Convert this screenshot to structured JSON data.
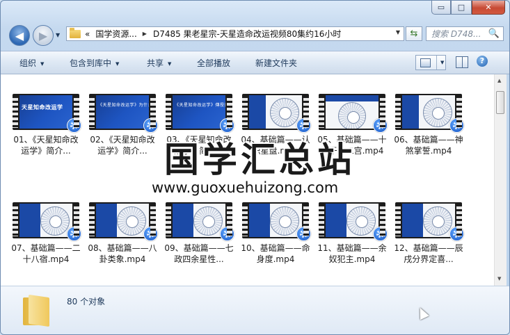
{
  "window": {
    "buttons": {
      "minimize": "▭",
      "maximize": "□",
      "close": "✕"
    }
  },
  "nav": {
    "back": "◀",
    "forward": "▶",
    "history": "▼",
    "refresh": "⇆"
  },
  "address": {
    "breadcrumbs": [
      "«",
      "国学资源...",
      "D7485 果老星宗-天星造命改运视频80集约16小时"
    ],
    "dropdown": "▼"
  },
  "search": {
    "placeholder": "搜索 D748...",
    "icon": "🔍"
  },
  "toolbar": {
    "organize": "组织",
    "include_library": "包含到库中",
    "share": "共享",
    "play_all": "全部播放",
    "new_folder": "新建文件夹"
  },
  "help": "?",
  "files": [
    {
      "name": "01、《天星知命改运学》简介...",
      "thumb_text": "天星知命改运学"
    },
    {
      "name": "02、《天星知命改运学》简介...",
      "thumb_text": "《天星知命改运学》为什么很少有人知"
    },
    {
      "name": "03、《天星知命改运学》简介...",
      "thumb_text": "《天星知命改运学》傳授的内容和意义"
    },
    {
      "name": "04、基础篇——认识星盘.mp4"
    },
    {
      "name": "05、基础篇——十天干十二宫.mp4"
    },
    {
      "name": "06、基础篇——神煞掌誓.mp4"
    },
    {
      "name": "07、基础篇——二十八宿.mp4"
    },
    {
      "name": "08、基础篇——八卦类象.mp4"
    },
    {
      "name": "09、基础篇——七政四余星性..."
    },
    {
      "name": "10、基础篇——命身度.mp4"
    },
    {
      "name": "11、基础篇——余奴犯主.mp4"
    },
    {
      "name": "12、基础篇——辰戌分界定喜..."
    }
  ],
  "status": {
    "count": "80 个对象"
  },
  "watermark": {
    "cn": "国学汇总站",
    "url": "www.guoxuehuizong.com"
  }
}
